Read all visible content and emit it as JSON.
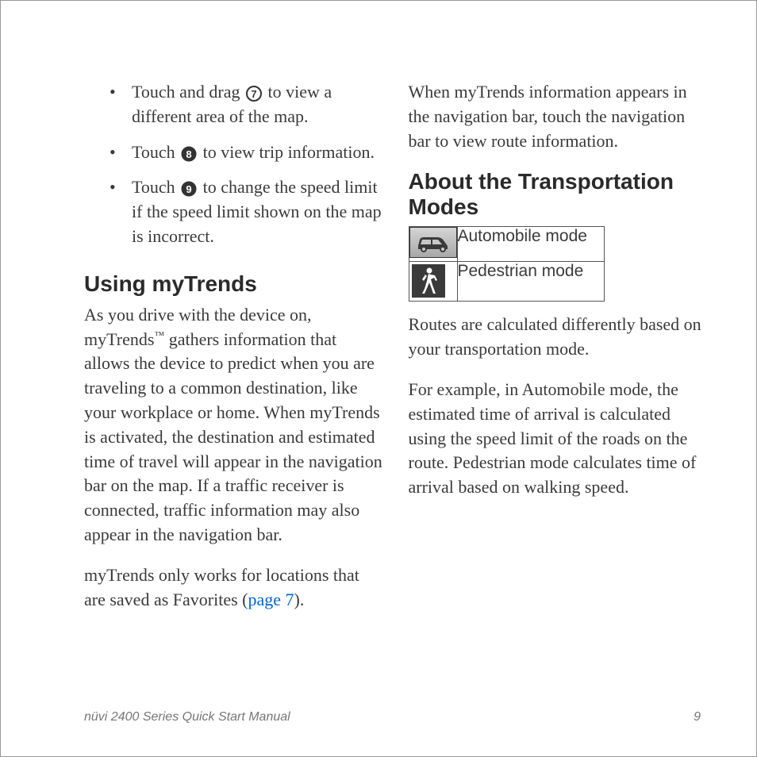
{
  "leftColumn": {
    "bullets": {
      "item1": {
        "pre": "Touch and drag ",
        "post": " to view a different area of the map."
      },
      "item2": {
        "pre": "Touch ",
        "post": " to view trip information."
      },
      "item3": {
        "pre": "Touch ",
        "post": " to change the speed limit if the speed limit shown on the map is incorrect."
      }
    },
    "heading": "Using myTrends",
    "para1": {
      "pre": "As you drive with the device on, myTrends",
      "tm": "™",
      "post": " gathers information that allows the device to predict when you are traveling to a common destination, like your workplace or home. When myTrends is activated, the destination and estimated time of travel will appear in the navigation bar on the map. If a traffic receiver is connected, traffic information may also appear in the navigation bar."
    },
    "para2": {
      "pre": "myTrends only works for locations that are saved as Favorites (",
      "link": "page 7",
      "post": ")."
    }
  },
  "rightColumn": {
    "para1": "When myTrends information appears in the navigation bar, touch the navigation bar to view route information.",
    "heading": "About the Transportation Modes",
    "modes": {
      "auto": "Automobile mode",
      "ped": "Pedestrian mode"
    },
    "para2": "Routes are calculated differently based on your transportation mode.",
    "para3": "For example, in Automobile mode, the estimated time of arrival is calculated using the speed limit of the roads on the route. Pedestrian mode calculates time of arrival based on walking speed."
  },
  "footer": {
    "title": "nüvi 2400 Series Quick Start Manual",
    "page": "9"
  }
}
